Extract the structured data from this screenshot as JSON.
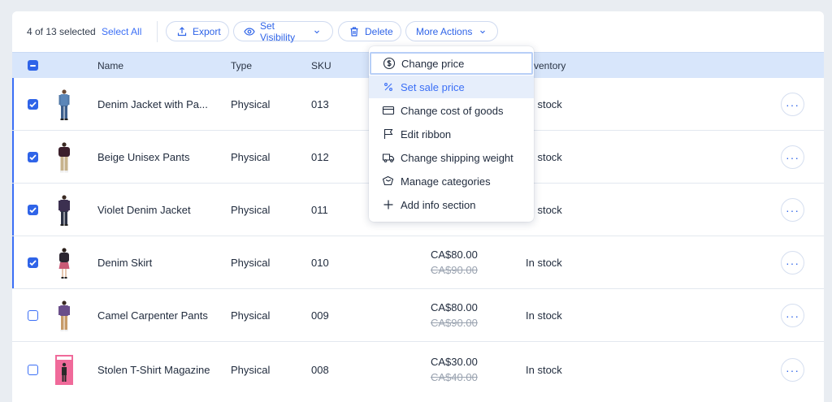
{
  "toolbar": {
    "selection_count": "4 of 13 selected",
    "select_all": "Select All",
    "export": "Export",
    "set_visibility": "Set Visibility",
    "delete": "Delete",
    "more_actions": "More Actions"
  },
  "table": {
    "headers": {
      "name": "Name",
      "type": "Type",
      "sku": "SKU",
      "inventory": "Inventory"
    },
    "rows": [
      {
        "name": "Denim Jacket with Pa...",
        "type": "Physical",
        "sku": "013",
        "price": "",
        "old_price": "",
        "inventory": "In stock",
        "selected": true
      },
      {
        "name": "Beige Unisex Pants",
        "type": "Physical",
        "sku": "012",
        "price": "",
        "old_price": "",
        "inventory": "In stock",
        "selected": true
      },
      {
        "name": "Violet Denim Jacket",
        "type": "Physical",
        "sku": "011",
        "price": "",
        "old_price": "",
        "inventory": "In stock",
        "selected": true
      },
      {
        "name": "Denim Skirt",
        "type": "Physical",
        "sku": "010",
        "price": "CA$80.00",
        "old_price": "CA$90.00",
        "inventory": "In stock",
        "selected": true
      },
      {
        "name": "Camel Carpenter Pants",
        "type": "Physical",
        "sku": "009",
        "price": "CA$80.00",
        "old_price": "CA$90.00",
        "inventory": "In stock",
        "selected": false
      },
      {
        "name": "Stolen T-Shirt Magazine",
        "type": "Physical",
        "sku": "008",
        "price": "CA$30.00",
        "old_price": "CA$40.00",
        "inventory": "In stock",
        "selected": false
      }
    ],
    "row_menu_glyph": "···"
  },
  "menu": {
    "items": [
      {
        "label": "Change price",
        "icon": "dollar-circle-icon"
      },
      {
        "label": "Set sale price",
        "icon": "percent-icon"
      },
      {
        "label": "Change cost of goods",
        "icon": "credit-card-icon"
      },
      {
        "label": "Edit ribbon",
        "icon": "flag-icon"
      },
      {
        "label": "Change shipping weight",
        "icon": "truck-icon"
      },
      {
        "label": "Manage categories",
        "icon": "tags-icon"
      },
      {
        "label": "Add info section",
        "icon": "plus-icon"
      }
    ]
  },
  "colors": {
    "accent": "#3b6ff6",
    "header_bg": "#d8e6fb",
    "page_bg": "#e9edf2",
    "menu_hover": "#e6eefb"
  }
}
